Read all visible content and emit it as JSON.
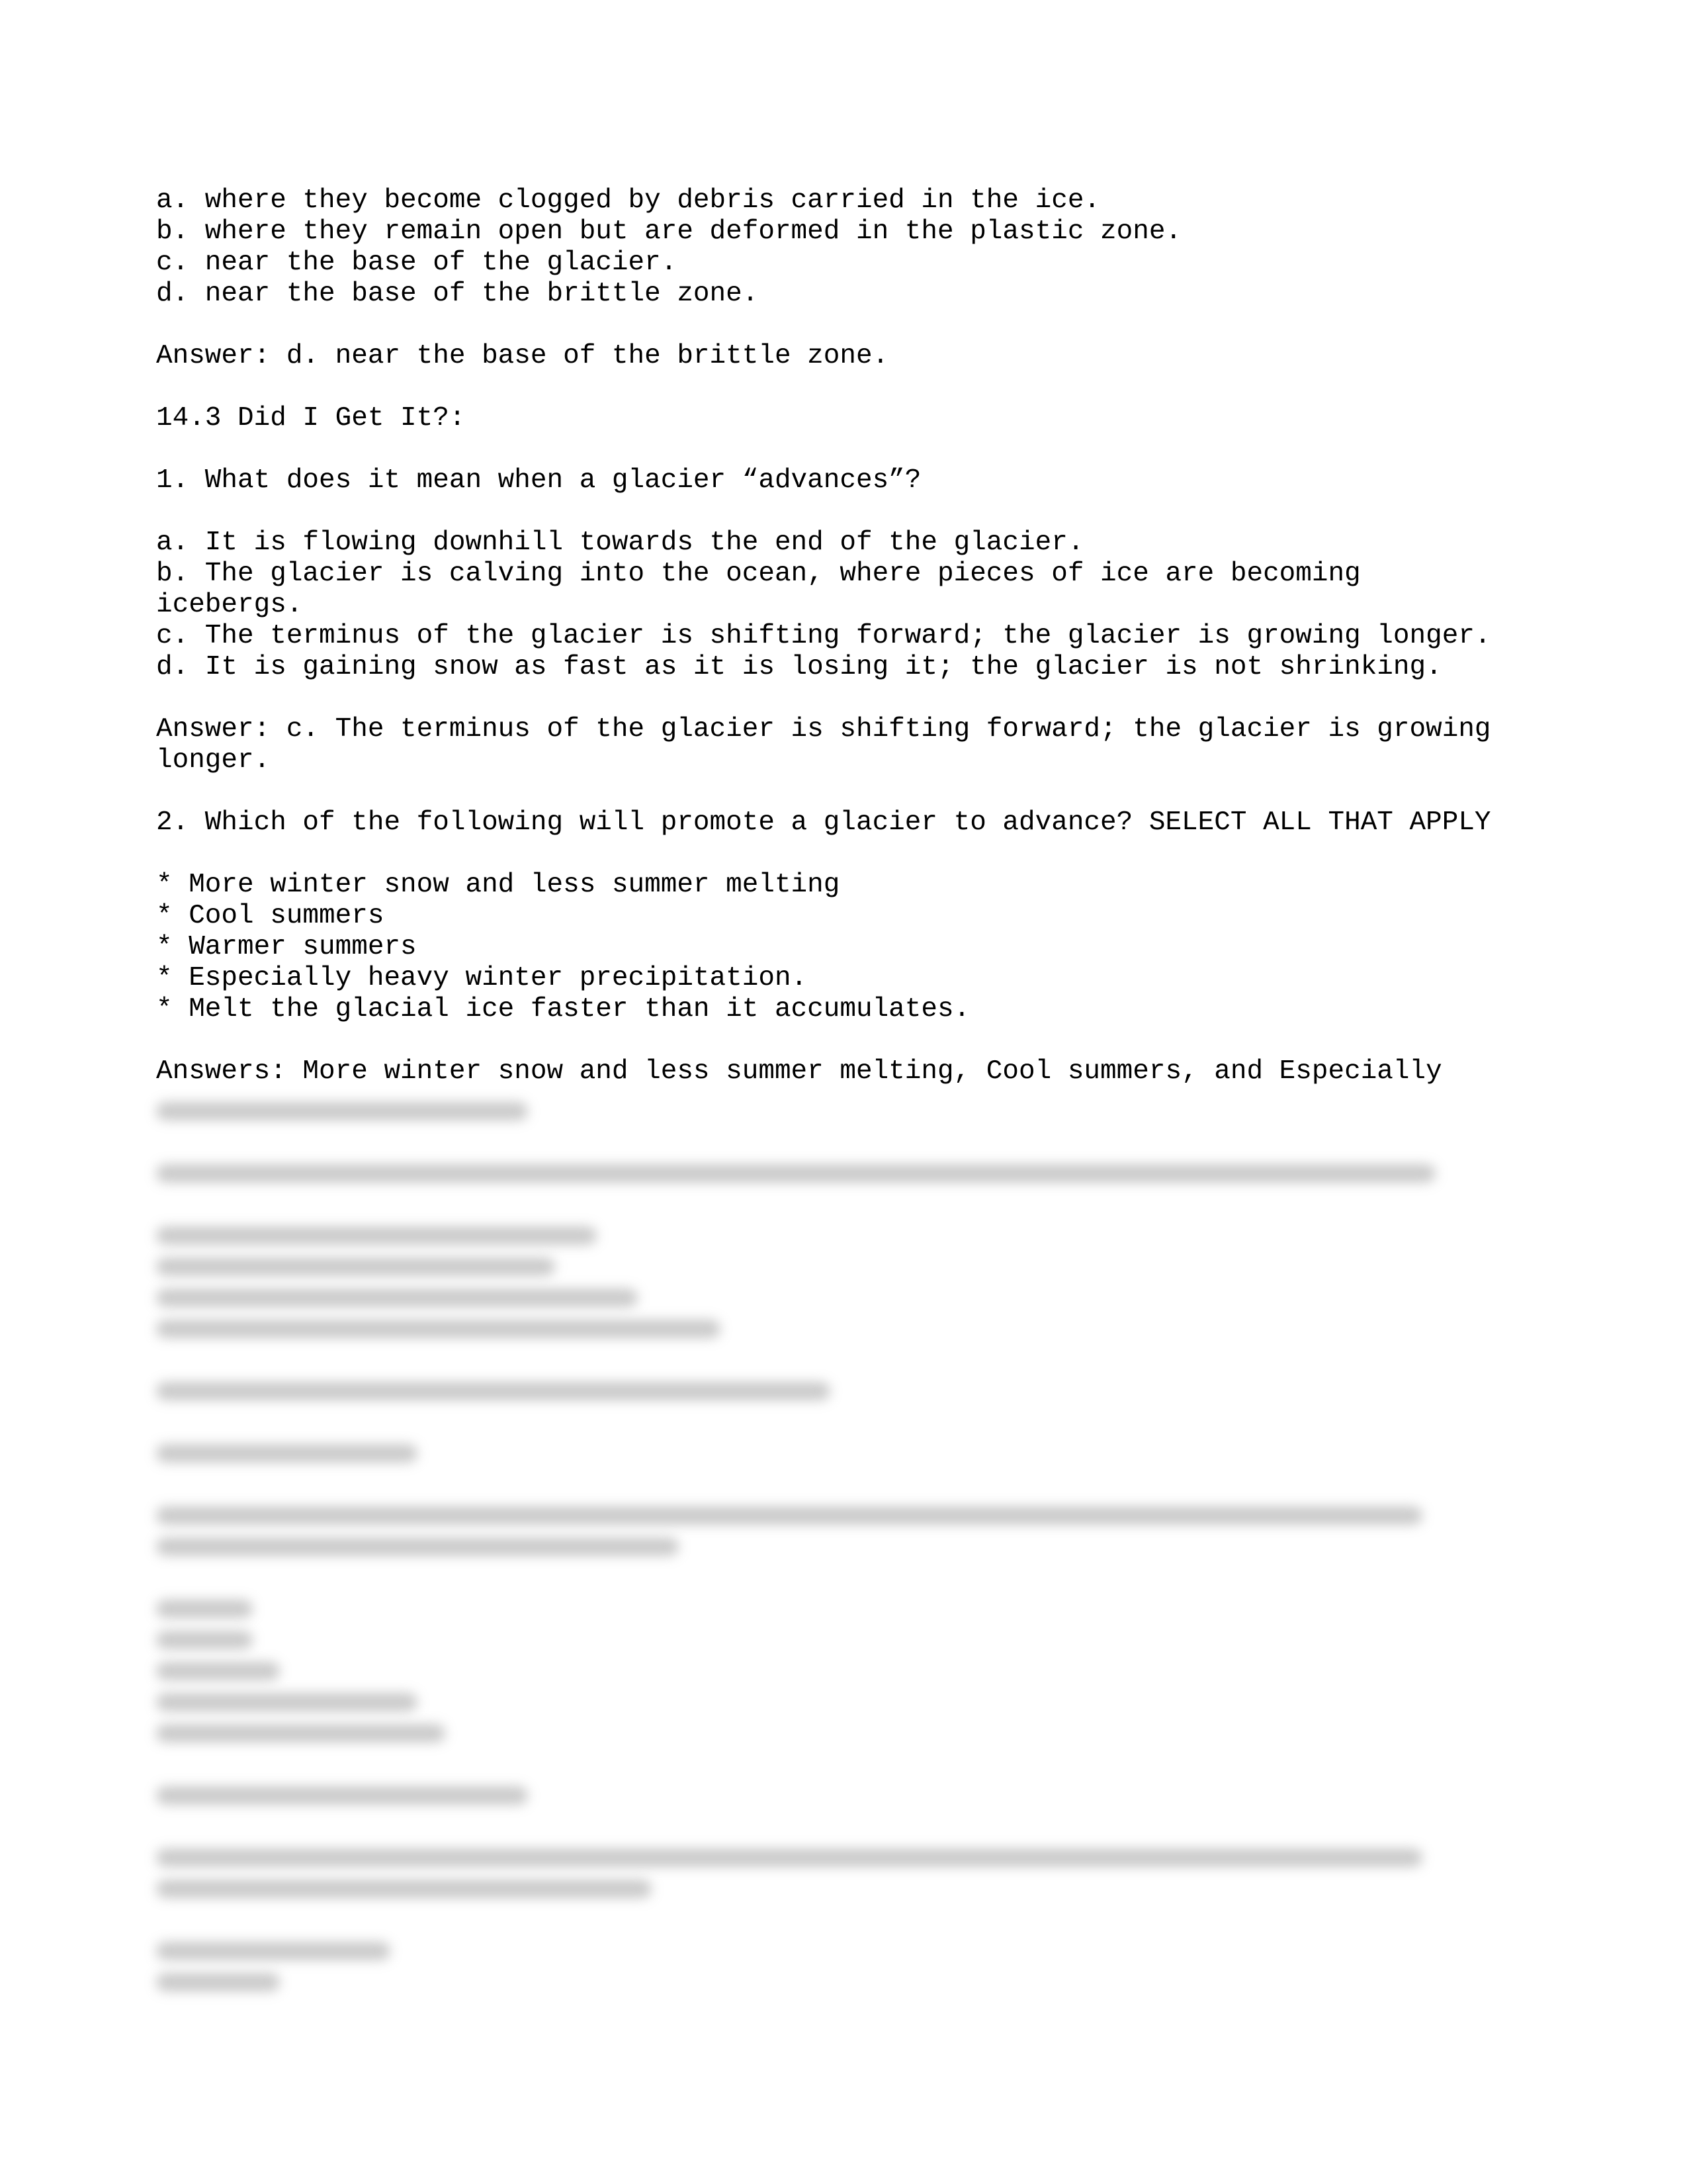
{
  "document": {
    "visible_lines": [
      {
        "type": "text",
        "text": "a. where they become clogged by debris carried in the ice."
      },
      {
        "type": "text",
        "text": "b. where they remain open but are deformed in the plastic zone."
      },
      {
        "type": "text",
        "text": "c. near the base of the glacier."
      },
      {
        "type": "text",
        "text": "d. near the base of the brittle zone."
      },
      {
        "type": "gap"
      },
      {
        "type": "text",
        "text": "Answer: d. near the base of the brittle zone."
      },
      {
        "type": "gap"
      },
      {
        "type": "text",
        "text": "14.3 Did I Get It?:"
      },
      {
        "type": "gap"
      },
      {
        "type": "text",
        "text": "1. What does it mean when a glacier “advances”?"
      },
      {
        "type": "gap"
      },
      {
        "type": "text",
        "text": "a. It is flowing downhill towards the end of the glacier."
      },
      {
        "type": "text",
        "text": "b. The glacier is calving into the ocean, where pieces of ice are becoming"
      },
      {
        "type": "text",
        "text": "icebergs."
      },
      {
        "type": "text",
        "text": "c. The terminus of the glacier is shifting forward; the glacier is growing longer."
      },
      {
        "type": "text",
        "text": "d. It is gaining snow as fast as it is losing it; the glacier is not shrinking."
      },
      {
        "type": "gap"
      },
      {
        "type": "text",
        "text": "Answer: c. The terminus of the glacier is shifting forward; the glacier is growing"
      },
      {
        "type": "text",
        "text": "longer."
      },
      {
        "type": "gap"
      },
      {
        "type": "text",
        "text": "2. Which of the following will promote a glacier to advance? SELECT ALL THAT APPLY"
      },
      {
        "type": "gap"
      },
      {
        "type": "text",
        "text": "* More winter snow and less summer melting"
      },
      {
        "type": "text",
        "text": "* Cool summers"
      },
      {
        "type": "text",
        "text": "* Warmer summers"
      },
      {
        "type": "text",
        "text": "* Especially heavy winter precipitation."
      },
      {
        "type": "text",
        "text": "* Melt the glacial ice faster than it accumulates."
      },
      {
        "type": "gap"
      },
      {
        "type": "text",
        "text": "Answers: More winter snow and less summer melting, Cool summers, and Especially"
      }
    ],
    "blurred_region": {
      "note": "Content is obscured/blurred in the screenshot and not legible",
      "lines": [
        {
          "type": "bar",
          "fill": 0.27
        },
        {
          "type": "gap"
        },
        {
          "type": "bar",
          "fill": 0.93
        },
        {
          "type": "gap"
        },
        {
          "type": "bar",
          "fill": 0.32
        },
        {
          "type": "bar",
          "fill": 0.29
        },
        {
          "type": "bar",
          "fill": 0.35
        },
        {
          "type": "bar",
          "fill": 0.41
        },
        {
          "type": "gap"
        },
        {
          "type": "bar",
          "fill": 0.49
        },
        {
          "type": "gap"
        },
        {
          "type": "bar",
          "fill": 0.19
        },
        {
          "type": "gap"
        },
        {
          "type": "bar",
          "fill": 0.92
        },
        {
          "type": "bar",
          "fill": 0.38
        },
        {
          "type": "gap"
        },
        {
          "type": "bar",
          "fill": 0.07
        },
        {
          "type": "bar",
          "fill": 0.07
        },
        {
          "type": "bar",
          "fill": 0.09
        },
        {
          "type": "bar",
          "fill": 0.19
        },
        {
          "type": "bar",
          "fill": 0.21
        },
        {
          "type": "gap"
        },
        {
          "type": "bar",
          "fill": 0.27
        },
        {
          "type": "gap"
        },
        {
          "type": "bar",
          "fill": 0.92
        },
        {
          "type": "bar",
          "fill": 0.36
        },
        {
          "type": "gap"
        },
        {
          "type": "bar",
          "fill": 0.17
        },
        {
          "type": "bar",
          "fill": 0.09
        }
      ]
    }
  }
}
